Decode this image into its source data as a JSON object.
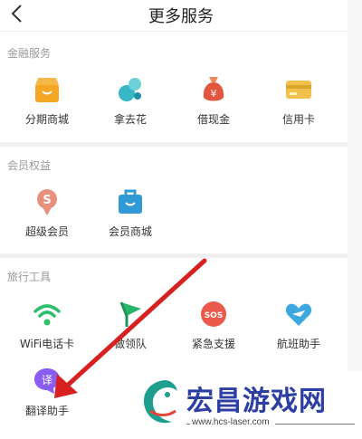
{
  "header": {
    "title": "更多服务",
    "back_icon": "chevron-left-icon"
  },
  "sections": [
    {
      "title": "金融服务",
      "items": [
        {
          "label": "分期商城",
          "icon": "shop-icon"
        },
        {
          "label": "拿去花",
          "icon": "flower-icon"
        },
        {
          "label": "借现金",
          "icon": "money-bag-icon"
        },
        {
          "label": "信用卡",
          "icon": "credit-card-icon"
        }
      ]
    },
    {
      "title": "会员权益",
      "items": [
        {
          "label": "超级会员",
          "icon": "super-vip-icon"
        },
        {
          "label": "会员商城",
          "icon": "member-mall-icon"
        }
      ]
    },
    {
      "title": "旅行工具",
      "items": [
        {
          "label": "WiFi电话卡",
          "icon": "wifi-icon"
        },
        {
          "label": "做领队",
          "icon": "flag-icon"
        },
        {
          "label": "紧急支援",
          "icon": "sos-icon"
        },
        {
          "label": "航班助手",
          "icon": "flight-heart-icon"
        },
        {
          "label": "翻译助手",
          "icon": "translate-icon"
        }
      ]
    }
  ],
  "watermark": {
    "title": "宏昌游戏网",
    "url": "www.hcs-laser.com",
    "logo_icon": "dragon-logo-icon"
  },
  "colors": {
    "arrow": "#d72020",
    "brand": "#2d3fa3",
    "shop": "#f5a623",
    "flower": "#37b6c6",
    "money": "#e2553f",
    "card": "#f0c24b",
    "vip": "#e8907e",
    "mall": "#2f9ad6",
    "wifi": "#2cc06a",
    "sos": "#e95a4a",
    "flight": "#3da7e0",
    "translate": "#8a5cf0"
  }
}
